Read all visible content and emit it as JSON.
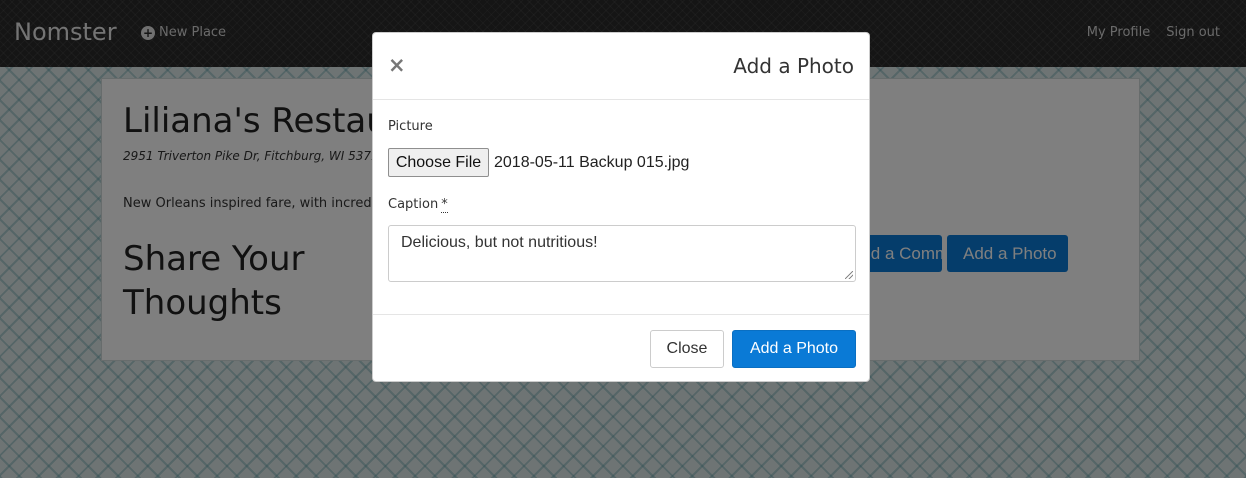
{
  "navbar": {
    "brand": "Nomster",
    "new_place": "New Place",
    "my_profile": "My Profile",
    "sign_out": "Sign out"
  },
  "place": {
    "name": "Liliana's Restaurant",
    "address": "2951 Triverton Pike Dr, Fitchburg, WI 53711",
    "description": "New Orleans inspired fare, with incredible desserts",
    "share_heading": "Share Your Thoughts",
    "comment_button": "Add a Comment",
    "photo_button": "Add a Photo"
  },
  "modal": {
    "close_symbol": "×",
    "title": "Add a Photo",
    "picture_label": "Picture",
    "choose_file": "Choose File",
    "file_name": "2018-05-11 Backup 015.jpg",
    "caption_label": "Caption",
    "required_marker": "*",
    "caption_value": "Delicious, but not nutritious!",
    "close_button": "Close",
    "submit_button": "Add a Photo"
  },
  "colors": {
    "primary": "#0a7ad6",
    "navbar": "#2a2a2a"
  }
}
